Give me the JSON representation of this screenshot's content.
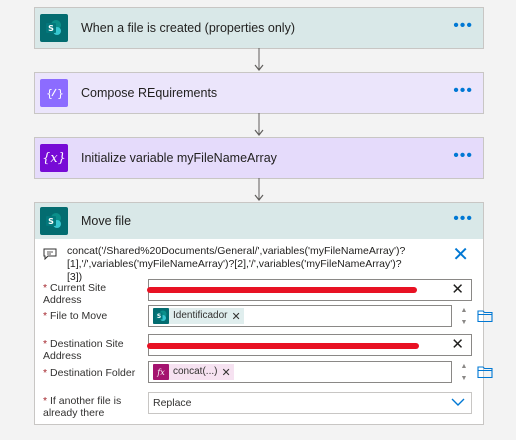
{
  "steps": {
    "trigger": {
      "title": "When a file is created (properties only)",
      "icon": "sharepoint-icon",
      "more": "•••"
    },
    "compose": {
      "title": "Compose REquirements",
      "icon": "compose-icon",
      "more": "•••"
    },
    "init_var": {
      "title": "Initialize variable myFileNameArray",
      "icon": "variable-icon",
      "icon_text": "{x}",
      "more": "•••"
    },
    "move_file": {
      "title": "Move file",
      "icon": "sharepoint-icon",
      "more": "•••"
    }
  },
  "move_file": {
    "info_line1": "concat('/Shared%20Documents/General/',variables('myFileNameArray')?",
    "info_line2": "[1],'/',variables('myFileNameArray')?[2],'/',variables('myFileNameArray')?[3])",
    "fields": {
      "current_site": {
        "required": "*",
        "label": "Current Site Address"
      },
      "file_to_move": {
        "required": "*",
        "label": "File to Move",
        "token": "Identificador",
        "token_icon_text": "S"
      },
      "dest_site": {
        "required": "*",
        "label": "Destination Site Address"
      },
      "dest_folder": {
        "required": "*",
        "label": "Destination Folder",
        "token": "concat(...)",
        "token_icon_text": "fx"
      },
      "if_exists": {
        "required": "*",
        "label": "If another file is already there",
        "value": "Replace"
      }
    }
  },
  "colors": {
    "sharepoint": "#036c70",
    "compose": "#8c6cff",
    "variable": "#770bd6",
    "accent": "#0078d4",
    "redaction": "#e81123"
  }
}
